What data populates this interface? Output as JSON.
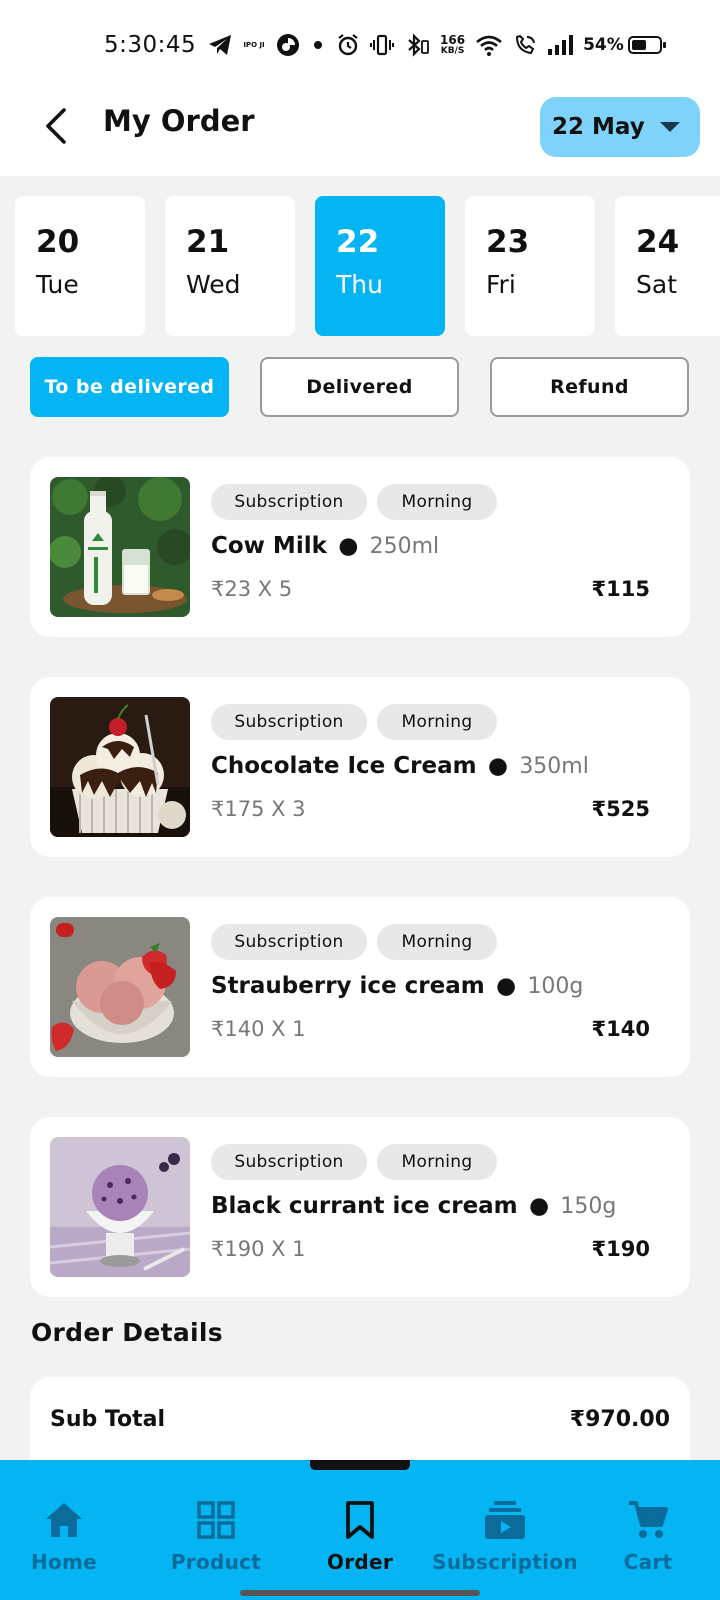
{
  "status_bar": {
    "time": "5:30:45",
    "speed_value": "166",
    "speed_unit": "KB/S",
    "battery": "54%",
    "battery_level": 0.54
  },
  "header": {
    "title": "My Order",
    "date_select": "22 May"
  },
  "days": [
    {
      "num": "20",
      "name": "Tue"
    },
    {
      "num": "21",
      "name": "Wed"
    },
    {
      "num": "22",
      "name": "Thu",
      "active": true
    },
    {
      "num": "23",
      "name": "Fri"
    },
    {
      "num": "24",
      "name": "Sat"
    }
  ],
  "filters": [
    {
      "label": "To be delivered",
      "active": true
    },
    {
      "label": "Delivered"
    },
    {
      "label": "Refund"
    }
  ],
  "orders": [
    {
      "tag_type": "Subscription",
      "tag_time": "Morning",
      "name": "Cow Milk",
      "dot": "●",
      "qty": "250ml",
      "unit": "₹23 X 5",
      "total": "₹115",
      "image": "milk-bottle"
    },
    {
      "tag_type": "Subscription",
      "tag_time": "Morning",
      "name": "Chocolate Ice Cream",
      "dot": "●",
      "qty": "350ml",
      "unit": "₹175 X 3",
      "total": "₹525",
      "image": "chocolate-sundae"
    },
    {
      "tag_type": "Subscription",
      "tag_time": "Morning",
      "name": "Strauberry ice cream",
      "dot": "●",
      "qty": "100g",
      "unit": "₹140 X 1",
      "total": "₹140",
      "image": "strawberry-scoops"
    },
    {
      "tag_type": "Subscription",
      "tag_time": "Morning",
      "name": "Black currant ice cream",
      "dot": "●",
      "qty": "150g",
      "unit": "₹190 X 1",
      "total": "₹190",
      "image": "blackcurrant-scoop"
    }
  ],
  "order_details": {
    "title": "Order Details",
    "sub_total_label": "Sub Total",
    "sub_total_value": "₹970.00"
  },
  "bottom_nav": [
    {
      "label": "Home",
      "icon": "home-icon"
    },
    {
      "label": "Product",
      "icon": "grid-icon"
    },
    {
      "label": "Order",
      "icon": "bookmark-icon",
      "active": true
    },
    {
      "label": "Subscription",
      "icon": "subscription-icon"
    },
    {
      "label": "Cart",
      "icon": "cart-icon"
    }
  ],
  "colors": {
    "accent": "#05b5f3",
    "accent_light": "#7fd3fa",
    "background": "#f2f2f2",
    "nav_label": "#0b6b9a"
  }
}
